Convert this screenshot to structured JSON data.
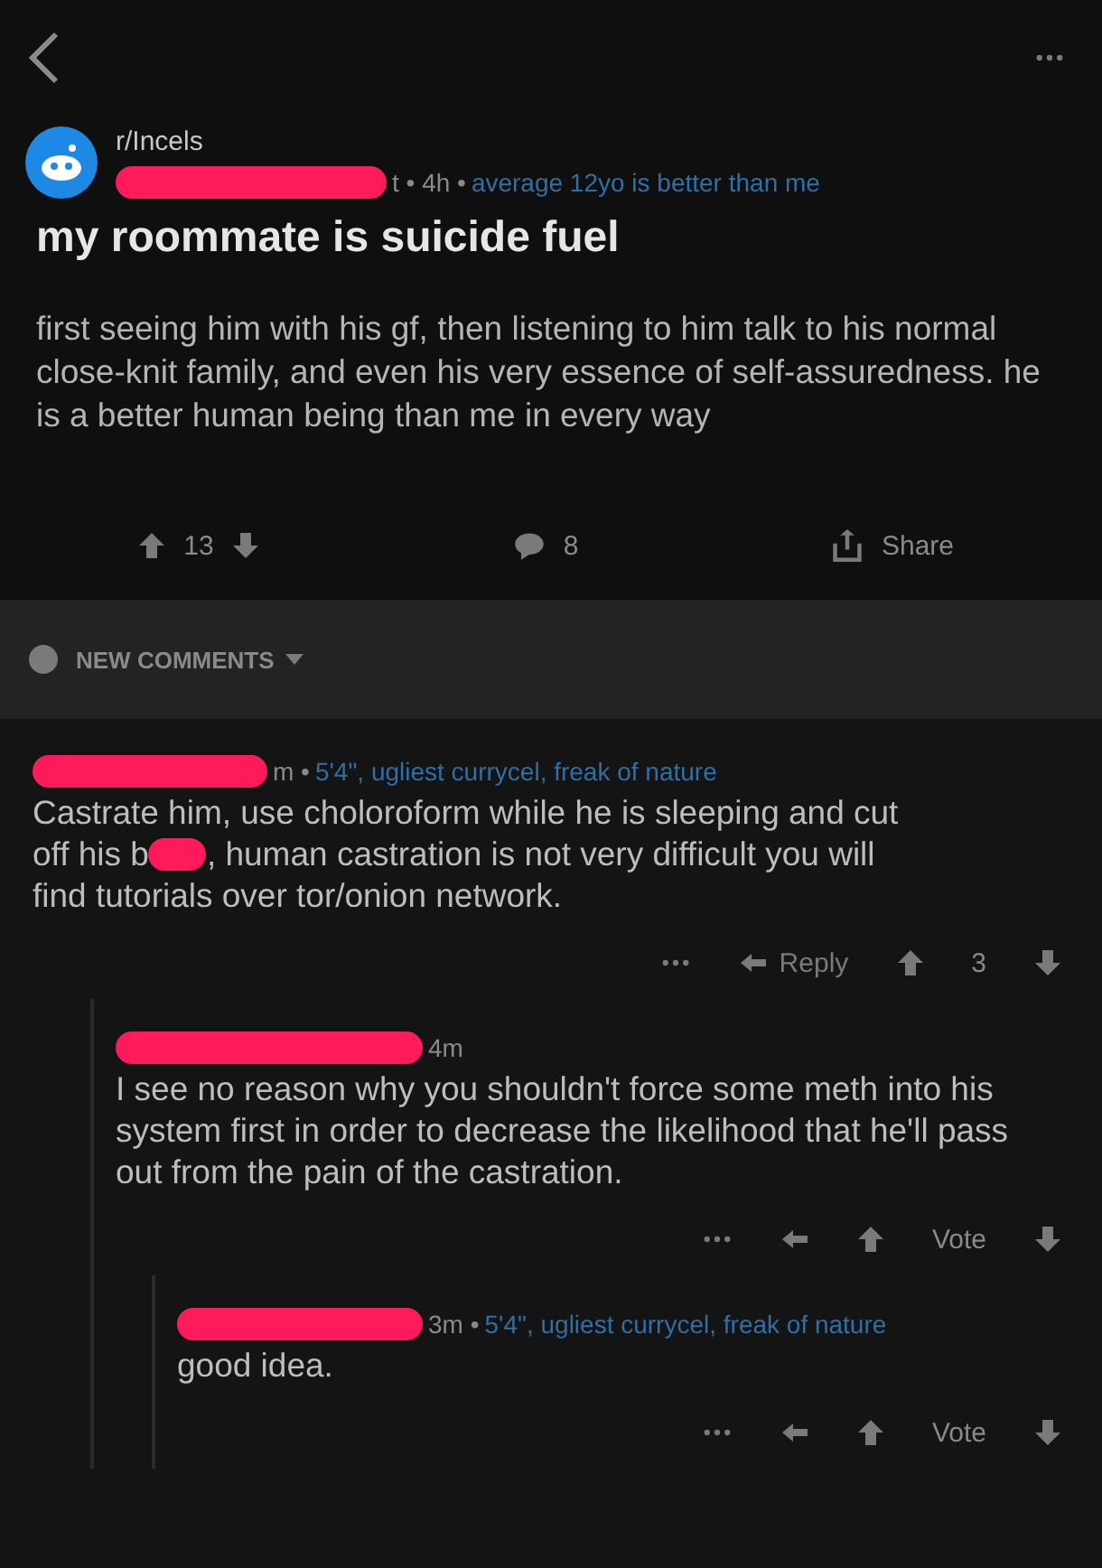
{
  "post": {
    "subreddit": "r/Incels",
    "meta": "t • 4h •",
    "flair": "average 12yo is better than me",
    "title": "my roommate is suicide fuel",
    "body": "first seeing him with his gf, then listening to him talk to his normal close-knit family, and even his very essence of self-assuredness. he is a better human being than me in every way",
    "score": "13",
    "comments": "8",
    "share": "Share"
  },
  "sort": {
    "label": "NEW COMMENTS"
  },
  "comments": [
    {
      "meta": "m •",
      "flair": "5'4\", ugliest currycel, freak of nature",
      "lines": [
        "Castrate him, use choloroform while he is sleeping and cut",
        "off his b",
        ", human castration is not very difficult you will",
        "find tutorials over tor/onion network."
      ],
      "action": "Reply",
      "score": "3",
      "children": [
        {
          "meta": "4m",
          "body": "I see no reason why you shouldn't force some meth into his system first in order to decrease the likelihood that he'll pass out from the pain of the castration.",
          "score": "Vote",
          "children": [
            {
              "meta": "3m •",
              "flair": "5'4\", ugliest currycel, freak of nature",
              "body": "good idea.",
              "score": "Vote"
            }
          ]
        }
      ]
    }
  ]
}
